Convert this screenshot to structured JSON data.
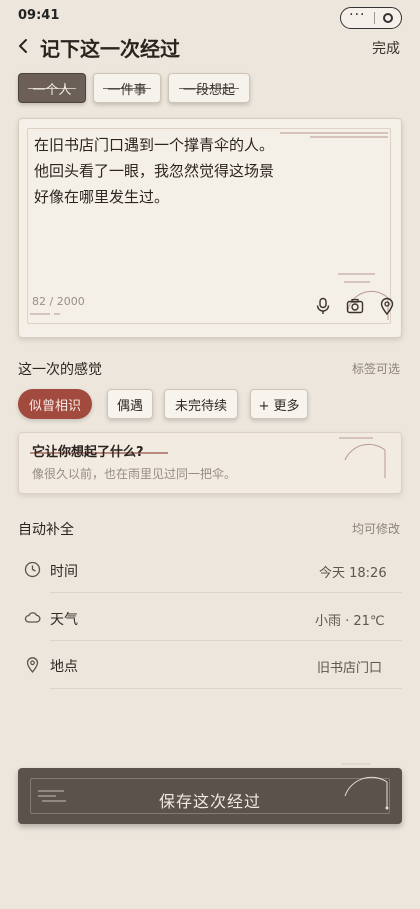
{
  "status_bar": {
    "time": "09:41",
    "menu_glyph": "···"
  },
  "nav": {
    "title": "记下这一次经过",
    "done_label": "完成"
  },
  "tabs": [
    {
      "label": "一个人",
      "active": true
    },
    {
      "label": "一件事",
      "active": false
    },
    {
      "label": "一段想起",
      "active": false
    }
  ],
  "entry": {
    "text": "在旧书店门口遇到一个撑青伞的人。\n他回头看了一眼，我忽然觉得这场景\n好像在哪里发生过。",
    "char_count": "82 / 2000",
    "tools": [
      "microphone-icon",
      "camera-icon",
      "location-pin-icon"
    ]
  },
  "feeling": {
    "title": "这一次的感觉",
    "hint": "标签可选",
    "chips": [
      {
        "label": "似曾相识",
        "selected": true
      },
      {
        "label": "偶遇",
        "selected": false
      },
      {
        "label": "未完待续",
        "selected": false
      },
      {
        "label": "+ 更多",
        "selected": false
      }
    ]
  },
  "memory": {
    "question": "它让你想起了什么?",
    "placeholder": "像很久以前，也在雨里见过同一把伞。"
  },
  "auto_fill": {
    "title": "自动补全",
    "hint": "均可修改",
    "rows": [
      {
        "icon": "clock-icon",
        "label": "时间",
        "value": "今天 18:26"
      },
      {
        "icon": "cloud-icon",
        "label": "天气",
        "value": "小雨 · 21℃"
      },
      {
        "icon": "location-pin-icon",
        "label": "地点",
        "value": "旧书店门口"
      }
    ]
  },
  "save": {
    "label": "保存这次经过"
  },
  "colors": {
    "background": "#ece6dc",
    "accent": "#a24a3e",
    "active_tab": "#6b5f58",
    "save_button": "#5c524c"
  }
}
